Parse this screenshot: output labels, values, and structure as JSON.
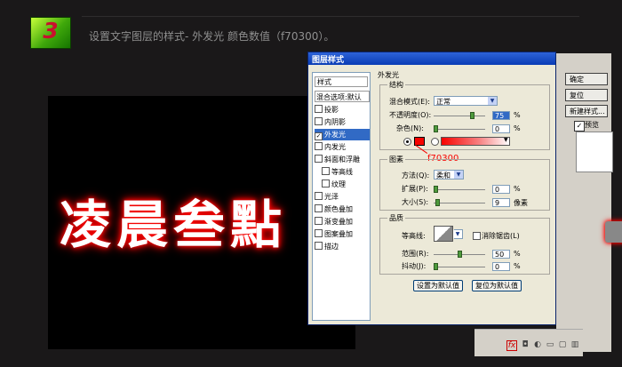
{
  "step": {
    "number": "3",
    "instruction": "设置文字图层的样式- 外发光 颜色数值（f70300）。"
  },
  "canvas": {
    "text": "凌晨叁點"
  },
  "dialog": {
    "title": "图层样式",
    "list_header": "样式",
    "blend_item": "混合选项:默认",
    "items": [
      {
        "label": "投影",
        "checked": false
      },
      {
        "label": "内阴影",
        "checked": false
      },
      {
        "label": "外发光",
        "checked": true
      },
      {
        "label": "内发光",
        "checked": false
      },
      {
        "label": "斜面和浮雕",
        "checked": false
      },
      {
        "label": "等高线",
        "checked": false
      },
      {
        "label": "纹理",
        "checked": false
      },
      {
        "label": "光泽",
        "checked": false
      },
      {
        "label": "颜色叠加",
        "checked": false
      },
      {
        "label": "渐变叠加",
        "checked": false
      },
      {
        "label": "图案叠加",
        "checked": false
      },
      {
        "label": "描边",
        "checked": false
      }
    ],
    "panel_title": "外发光",
    "structure": {
      "label": "结构",
      "blend_mode_label": "混合模式(E):",
      "blend_mode_value": "正常",
      "opacity_label": "不透明度(O):",
      "opacity_value": "75",
      "opacity_unit": "%",
      "opacity_level": 0.75,
      "noise_label": "杂色(N):",
      "noise_value": "0",
      "noise_unit": "%",
      "glow_color": "#f70300",
      "color_annotation": "f70300"
    },
    "elements": {
      "label": "图素",
      "technique_label": "方法(Q):",
      "technique_value": "柔和",
      "spread_label": "扩展(P):",
      "spread_value": "0",
      "spread_unit": "%",
      "size_label": "大小(S):",
      "size_value": "9",
      "size_unit": "像素"
    },
    "quality": {
      "label": "品质",
      "contour_label": "等高线:",
      "anti_alias_label": "消除锯齿(L)",
      "range_label": "范围(R):",
      "range_value": "50",
      "range_unit": "%",
      "jitter_label": "抖动(J):",
      "jitter_value": "0",
      "jitter_unit": "%"
    },
    "set_default_btn": "设置为默认值",
    "reset_default_btn": "复位为默认值"
  },
  "side": {
    "ok_btn": "确定",
    "reset_btn": "复位",
    "new_style_btn": "新建样式...",
    "preview_label": "预览"
  },
  "layers_bar": {
    "fx_label": "fx"
  }
}
